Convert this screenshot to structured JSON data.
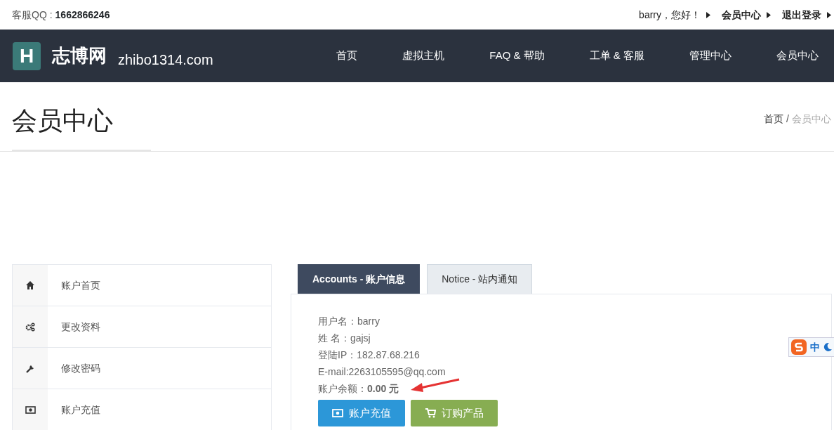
{
  "top_bar": {
    "qq_label": "客服QQ :",
    "qq_number": "1662866246",
    "links": [
      {
        "label": "barry，您好！"
      },
      {
        "label": "会员中心"
      },
      {
        "label": "退出登录"
      }
    ]
  },
  "navbar": {
    "logo": {
      "letter": "H",
      "name": "志博网",
      "domain": "zhibo1314.com"
    },
    "items": [
      {
        "label": "首页"
      },
      {
        "label": "虚拟主机"
      },
      {
        "label": "FAQ & 帮助"
      },
      {
        "label": "工单 & 客服"
      },
      {
        "label": "管理中心"
      },
      {
        "label": "会员中心"
      }
    ]
  },
  "page_header": {
    "title": "会员中心",
    "breadcrumb": [
      {
        "label": "首页",
        "current": false
      },
      {
        "label": "会员中心",
        "current": true
      }
    ],
    "separator": "/"
  },
  "sidebar": {
    "items": [
      {
        "label": "账户首页",
        "kind": "home"
      },
      {
        "label": "更改资料",
        "kind": "gears"
      },
      {
        "label": "修改密码",
        "kind": "wrench"
      },
      {
        "label": "账户充值",
        "kind": "money"
      }
    ]
  },
  "tabs": [
    {
      "label": "Accounts - 账户信息",
      "selected": true
    },
    {
      "label": "Notice - 站内通知",
      "selected": false
    }
  ],
  "account": {
    "lines": [
      {
        "text": "用户名：barry"
      },
      {
        "text": "姓 名：gajsj"
      },
      {
        "text": "登陆IP：182.87.68.216"
      },
      {
        "text": "E-mail:2263105595@qq.com"
      },
      {
        "text": "账户余额：**0.00 元**"
      }
    ],
    "buttons": [
      {
        "label": "账户充值",
        "kind": "recharge"
      },
      {
        "label": "订购产品",
        "kind": "order"
      }
    ]
  },
  "ime_bar": {
    "label": "中"
  }
}
